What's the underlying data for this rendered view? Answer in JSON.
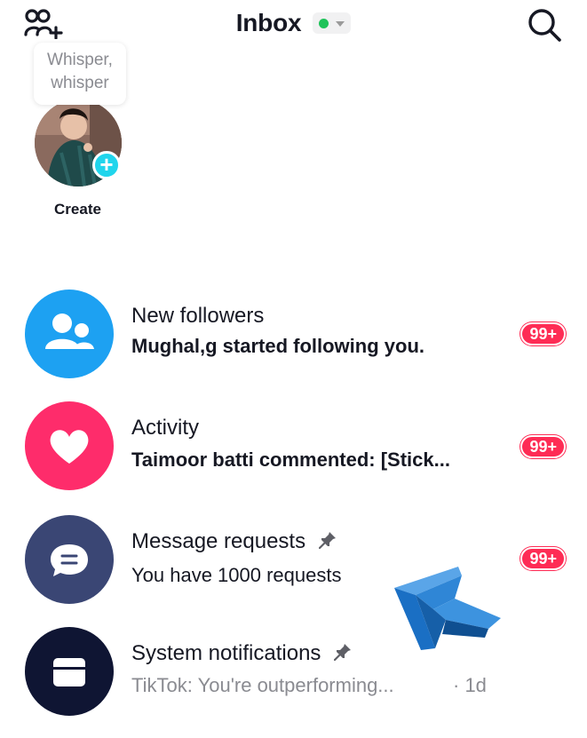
{
  "header": {
    "title": "Inbox",
    "status_color": "#1fc35a",
    "icons": {
      "left": "add-friends-icon",
      "right": "search-icon"
    }
  },
  "story": {
    "bubble_text_line1": "Whisper,",
    "bubble_text_line2": "whisper",
    "create_label": "Create",
    "plus_symbol": "+"
  },
  "inbox_items": [
    {
      "title": "New followers",
      "subtitle": "Mughal,g started following you.",
      "badge": "99+",
      "icon": "followers-icon",
      "color": "#1da1f2"
    },
    {
      "title": "Activity",
      "subtitle": "Taimoor batti commented: [Stick...",
      "badge": "99+",
      "icon": "heart-icon",
      "color": "#fe2c6b"
    },
    {
      "title": "Message requests",
      "subtitle": "You have 1000 requests",
      "badge": "99+",
      "icon": "message-icon",
      "color": "#3a4674",
      "pinned": true
    },
    {
      "title": "System notifications",
      "subtitle": "TikTok: You're outperforming...",
      "time": "· 1d",
      "icon": "inbox-tray-icon",
      "color": "#0f1533",
      "pinned": true
    }
  ],
  "accent_colors": {
    "badge": "#fe2c55",
    "plus": "#20d5ec"
  }
}
